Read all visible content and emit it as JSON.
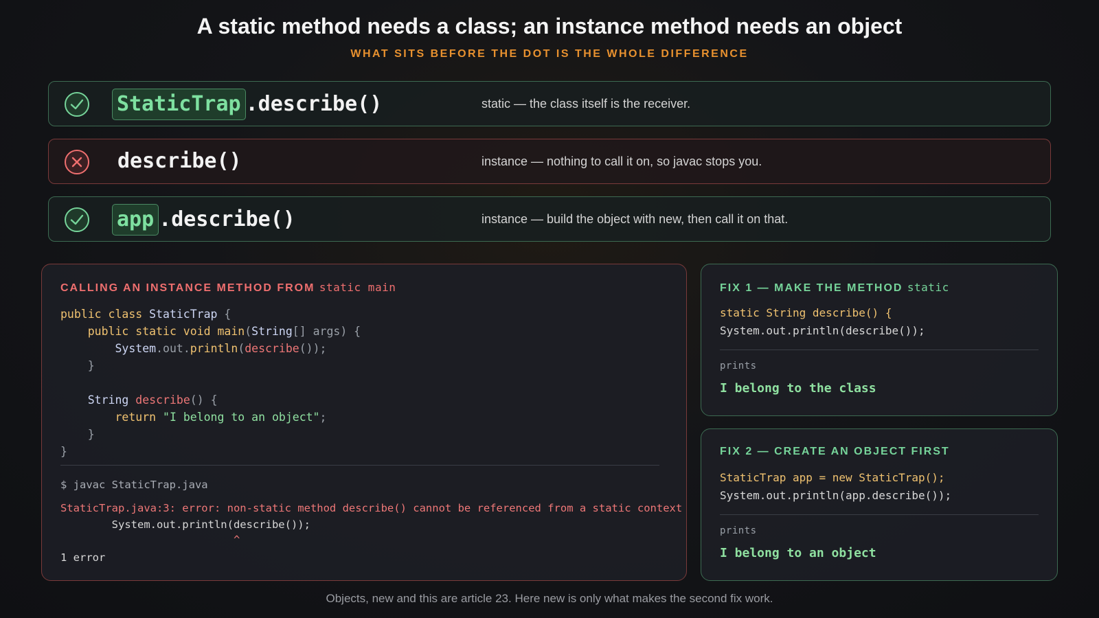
{
  "header": {
    "title": "A static method needs a class; an instance method needs an object",
    "subtitle": "WHAT SITS BEFORE THE DOT IS THE WHOLE DIFFERENCE"
  },
  "rows": [
    {
      "status": "ok",
      "icon": "check-circle-icon",
      "receiver": "StaticTrap",
      "call": ".describe()",
      "description": "static — the class itself is the receiver."
    },
    {
      "status": "error",
      "icon": "x-circle-icon",
      "receiver": "",
      "call": "describe()",
      "description": "instance — nothing to call it on, so javac stops you."
    },
    {
      "status": "ok",
      "icon": "check-circle-icon",
      "receiver": "app",
      "call": ".describe()",
      "description": "instance — build the object with new, then call it on that."
    }
  ],
  "error_panel": {
    "heading_text": "CALLING AN INSTANCE METHOD FROM ",
    "heading_keyword": "static main",
    "code": {
      "l1a": "public class ",
      "l1b": "StaticTrap",
      "l1c": " {",
      "l2a": "    public static void ",
      "l2b": "main",
      "l2c": "(",
      "l2d": "String",
      "l2e": "[] args) {",
      "l3a": "        System",
      "l3b": ".",
      "l3c": "out",
      "l3d": ".",
      "l3e": "println",
      "l3f": "(",
      "l3g": "describe",
      "l3h": "());",
      "l4": "    }",
      "l6a": "    String ",
      "l6b": "describe",
      "l6c": "() {",
      "l7a": "        return ",
      "l7b": "\"I belong to an object\"",
      "l7c": ";",
      "l8": "    }",
      "l9": "}"
    },
    "terminal": {
      "command": "$ javac StaticTrap.java",
      "error": "StaticTrap.java:3: error: non-static method describe() cannot be referenced from a static context",
      "source_line": "        System.out.println(describe());",
      "caret": "                           ^",
      "count": "1 error"
    }
  },
  "fixes": [
    {
      "heading_text": "FIX 1 — MAKE THE METHOD ",
      "heading_keyword": "static",
      "line1": "static String describe() {",
      "line2": "System.out.println(describe());",
      "prints_label": "prints",
      "prints_value": "I belong to the class"
    },
    {
      "heading_text": "FIX 2 — CREATE AN OBJECT FIRST",
      "heading_keyword": "",
      "line1": "StaticTrap app = new StaticTrap();",
      "line2": "System.out.println(app.describe());",
      "prints_label": "prints",
      "prints_value": "I belong to an object"
    }
  ],
  "footer": "Objects, new and this are article 23. Here new is only what makes the second fix work.",
  "colors": {
    "ok": "#76d49a",
    "error": "#ef6f6f",
    "accent": "#e8912f"
  }
}
